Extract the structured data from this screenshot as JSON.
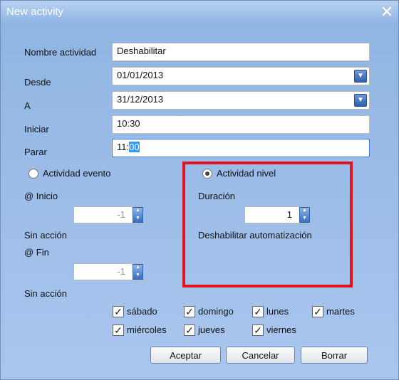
{
  "window": {
    "title": "New activity",
    "close_label": "✕"
  },
  "form": {
    "nombre_label": "Nombre actividad",
    "nombre_value": "Deshabilitar",
    "desde_label": "Desde",
    "desde_value": "01/01/2013",
    "a_label": "A",
    "a_value": "31/12/2013",
    "iniciar_label": "Iniciar",
    "iniciar_value": "10:30",
    "parar_label": "Parar",
    "parar_value_start": "11:",
    "parar_value_sel": "00"
  },
  "left": {
    "radio_label": "Actividad evento",
    "inicio_label": "@ Inicio",
    "inicio_value": "-1",
    "sin_accion_1": "Sin acción",
    "fin_label": "@ Fin",
    "fin_value": "-1",
    "sin_accion_2": "Sin acción"
  },
  "right": {
    "radio_label": "Actividad nivel",
    "duracion_label": "Duración",
    "duracion_value": "1",
    "action_label": "Deshabilitar automatización"
  },
  "days": [
    "sábado",
    "domingo",
    "lunes",
    "martes",
    "miércoles",
    "jueves",
    "viernes"
  ],
  "buttons": {
    "aceptar": "Aceptar",
    "cancelar": "Cancelar",
    "borrar": "Borrar"
  },
  "colors": {
    "highlight": "#e0141e",
    "titlebar": "#8db2e3",
    "selection": "#3399ff"
  }
}
